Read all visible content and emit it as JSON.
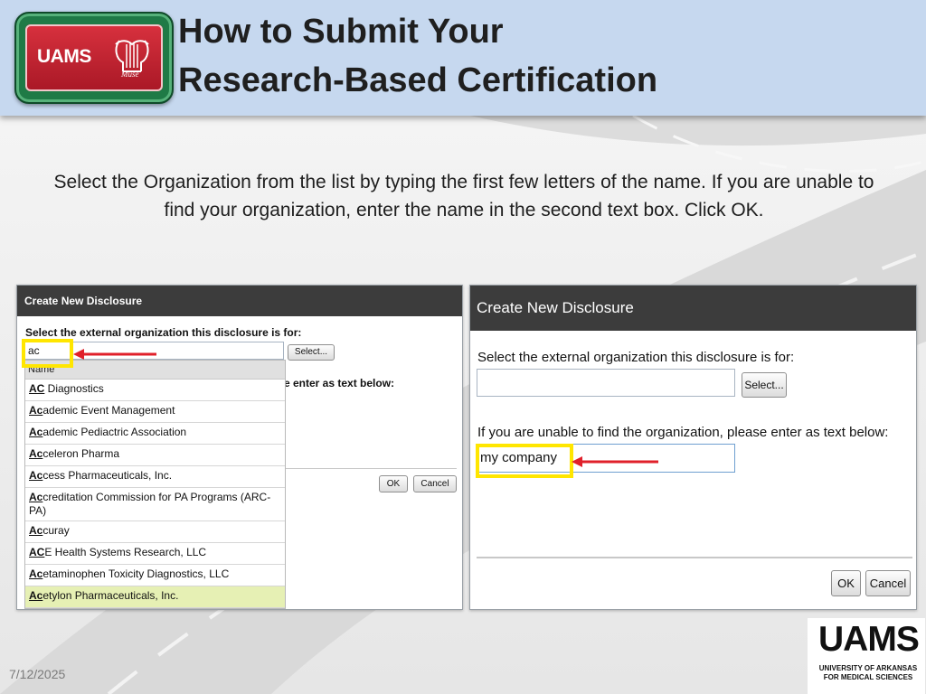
{
  "header": {
    "logo_text": "UAMS",
    "logo_subtext": "Muse",
    "title_line1": "How to Submit Your",
    "title_line2": "Research-Based Certification"
  },
  "instruction": "Select the Organization from the list by typing the first few letters of the name.  If you are unable to find your organization, enter the name in the second text box. Click OK.",
  "left_screenshot": {
    "dialog_title": "Create New Disclosure",
    "org_label": "Select the external organization this disclosure is for:",
    "search_value": "ac",
    "select_button": "Select...",
    "hidden_label_fragment": "e enter as text below:",
    "ok_button": "OK",
    "cancel_button": "Cancel",
    "dropdown_header": "Name",
    "dropdown_items": [
      {
        "match": "AC",
        "rest": " Diagnostics"
      },
      {
        "match": "Ac",
        "rest": "ademic Event Management"
      },
      {
        "match": "Ac",
        "rest": "ademic Pediactric Association"
      },
      {
        "match": "Ac",
        "rest": "celeron Pharma"
      },
      {
        "match": "Ac",
        "rest": "cess Pharmaceuticals, Inc."
      },
      {
        "match": "Ac",
        "rest": "creditation Commission for PA Programs (ARC-PA)"
      },
      {
        "match": "Ac",
        "rest": "curay"
      },
      {
        "match": "AC",
        "rest": "E Health Systems Research, LLC"
      },
      {
        "match": "Ac",
        "rest": "etaminophen Toxicity Diagnostics, LLC"
      },
      {
        "match": "Ac",
        "rest": "etylon Pharmaceuticals, Inc."
      }
    ]
  },
  "right_screenshot": {
    "dialog_title": "Create New Disclosure",
    "org_label": "Select the external organization this disclosure is for:",
    "org_value": "",
    "select_button": "Select...",
    "text_label": "If you are unable to find the organization, please enter as text below:",
    "text_value": "my company",
    "ok_button": "OK",
    "cancel_button": "Cancel"
  },
  "footer": {
    "date": "7/12/2025",
    "uams_logo_text": "UAMS",
    "uams_subtitle": "UNIVERSITY OF ARKANSAS FOR MEDICAL SCIENCES"
  },
  "colors": {
    "header_bg": "#c6d8ef",
    "highlight": "#ffe600",
    "arrow": "#e0202a",
    "dialog_title_bg": "#3c3c3c"
  }
}
